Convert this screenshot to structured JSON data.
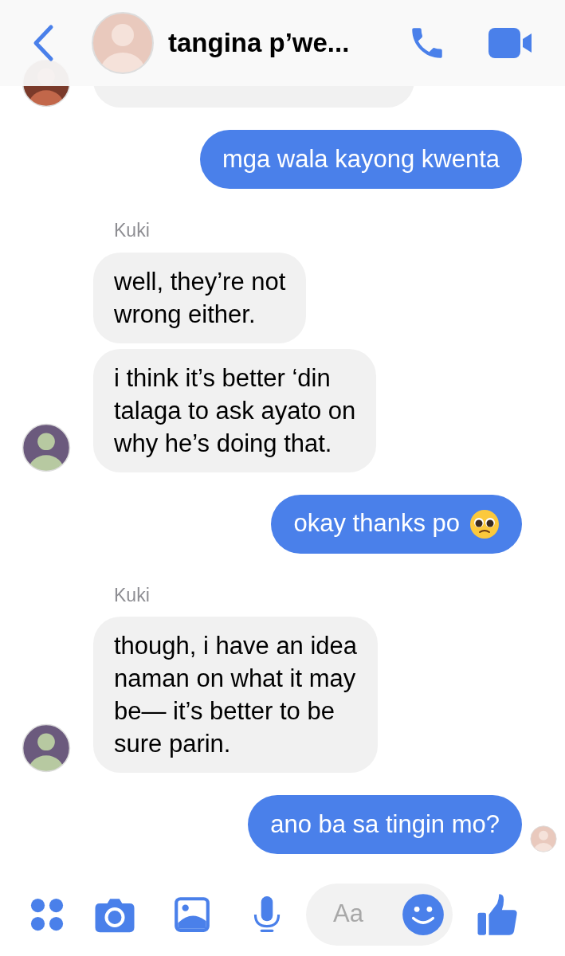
{
  "header": {
    "title": "tangina p’we..."
  },
  "messages": [
    {
      "kind": "cut",
      "avatar": true
    },
    {
      "kind": "outgoing",
      "text": "mga wala kayong kwenta"
    },
    {
      "kind": "sender",
      "text": "Kuki"
    },
    {
      "kind": "incoming",
      "avatar": false,
      "text": "well, they’re not\nwrong either."
    },
    {
      "kind": "incoming",
      "avatar": true,
      "text": "i think it’s better ‘din\ntalaga to ask ayato on\nwhy he’s doing that."
    },
    {
      "kind": "outgoing",
      "text": "okay thanks po",
      "emoji": true
    },
    {
      "kind": "sender",
      "text": "Kuki"
    },
    {
      "kind": "incoming",
      "avatar": true,
      "text": "though, i have an idea\nnaman on what it may\nbe— it’s better to be\nsure parin."
    },
    {
      "kind": "outgoing",
      "text": "ano ba sa tingin mo?",
      "seen": true
    }
  ],
  "composer": {
    "placeholder": "Aa"
  }
}
